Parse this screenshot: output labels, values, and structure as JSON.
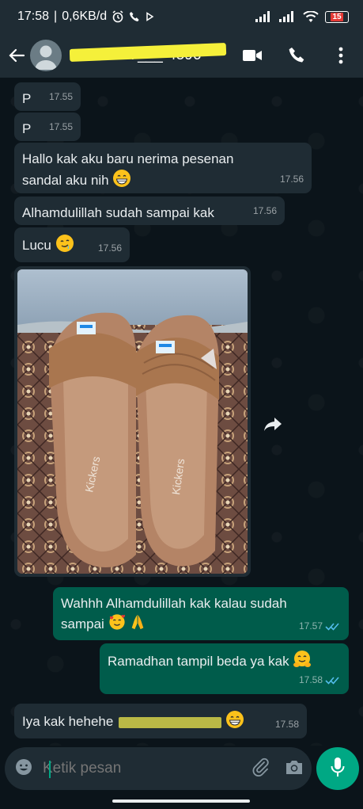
{
  "status_bar": {
    "time": "17:58",
    "network_speed": "0,6KB/d",
    "battery": "15"
  },
  "header": {
    "contact_name": "+62 822-7___-4596",
    "icons": [
      "back-arrow-icon",
      "avatar-icon",
      "video-call-icon",
      "phone-icon",
      "more-options-icon"
    ]
  },
  "messages": [
    {
      "dir": "in",
      "text": "P",
      "time": "17.55"
    },
    {
      "dir": "in",
      "text": "P",
      "time": "17.55"
    },
    {
      "dir": "in",
      "text_line1": "Hallo kak aku baru nerima pesenan",
      "text_line2": "sandal aku nih",
      "emoji": "grinning-face",
      "time": "17.56"
    },
    {
      "dir": "in",
      "text": "Alhamdulillah sudah sampai kak",
      "time": "17.56"
    },
    {
      "dir": "in",
      "text": "Lucu",
      "emoji": "drooling-face",
      "time": "17.56"
    },
    {
      "dir": "in",
      "type": "image",
      "image_brand_text": "Kickers",
      "time": ""
    },
    {
      "dir": "out",
      "text_line1": "Wahhh Alhamdulillah kak kalau sudah",
      "text_line2": "sampai",
      "emoji": "smiling-hearts-praying-hands",
      "time": "17.57",
      "status": "read"
    },
    {
      "dir": "out",
      "text": "Ramadhan tampil beda ya kak",
      "emoji": "hugging-face",
      "time": "17.58",
      "status": "read"
    },
    {
      "dir": "in",
      "text": "Iya kak hehehe",
      "emoji": "grinning-face",
      "time": "17.58"
    }
  ],
  "composer": {
    "placeholder": "Ketik pesan",
    "icons": [
      "emoji-icon",
      "attach-icon",
      "camera-icon",
      "mic-icon"
    ]
  },
  "colors": {
    "incoming_bubble": "#1f2c34",
    "outgoing_bubble": "#005c4b",
    "accent": "#00a884",
    "read_ticks": "#53bdeb"
  }
}
